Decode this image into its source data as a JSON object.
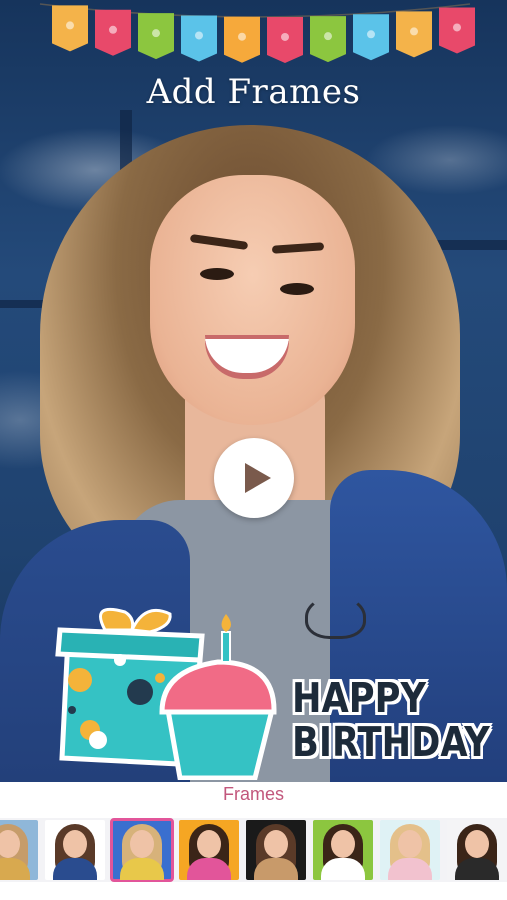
{
  "header": {
    "title": "Add Frames"
  },
  "sticker": {
    "line1": "HAPPY",
    "line2": "BIRTHDAY"
  },
  "panel": {
    "label": "Frames"
  },
  "colors": {
    "accent": "#c2577c",
    "selected_outline": "#e2559a",
    "bunting": [
      "#f4b34a",
      "#e8496a",
      "#8cc63f",
      "#5bc3e9",
      "#f6a93b",
      "#e8496a",
      "#8cc63f",
      "#5bc3e9",
      "#f4b34a",
      "#e8496a"
    ]
  },
  "frames": [
    {
      "bg": "#8fb7d9",
      "hair": "#c69c6a",
      "body": "#d8a94f",
      "selected": false
    },
    {
      "bg": "#ffffff",
      "hair": "#5a3a28",
      "body": "#2a4c8f",
      "selected": false
    },
    {
      "bg": "#3a6fcf",
      "hair": "#d7b27a",
      "body": "#e8c84a",
      "selected": true
    },
    {
      "bg": "#f5a623",
      "hair": "#3b2518",
      "body": "#e2559a",
      "selected": false
    },
    {
      "bg": "#1a1a1a",
      "hair": "#5a3a28",
      "body": "#c89a6a",
      "selected": false
    },
    {
      "bg": "#8cc63f",
      "hair": "#3b2518",
      "body": "#ffffff",
      "selected": false
    },
    {
      "bg": "#dff2f5",
      "hair": "#e4c08a",
      "body": "#f2c2cf",
      "selected": false
    },
    {
      "bg": "#f4f4f6",
      "hair": "#3b2518",
      "body": "#2a2a2a",
      "selected": false
    }
  ],
  "icons": {
    "play": "play-icon"
  }
}
